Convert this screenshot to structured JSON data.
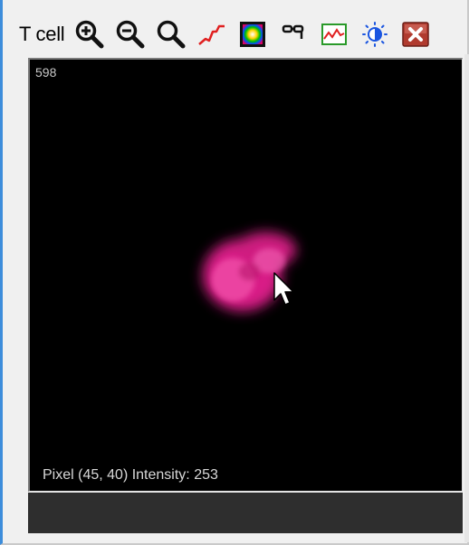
{
  "window": {
    "title": "T cell"
  },
  "toolbar": {
    "buttons": [
      {
        "icon": "zoom-in-icon"
      },
      {
        "icon": "zoom-out-icon"
      },
      {
        "icon": "magnifier-icon"
      },
      {
        "icon": "curve-icon"
      },
      {
        "icon": "colormap-icon"
      },
      {
        "icon": "binoculars-icon"
      },
      {
        "icon": "histogram-icon"
      },
      {
        "icon": "contrast-icon"
      },
      {
        "icon": "close-icon"
      }
    ]
  },
  "viewer": {
    "frame_number": "598",
    "pixel_readout": "Pixel (45, 40) Intensity: 253",
    "background_color": "#000000",
    "cell_color": "#e0218a"
  },
  "colors": {
    "accent_frame": "#3d8ddb",
    "curve_red": "#e02020",
    "contrast_blue": "#1a55e0",
    "close_red": "#c0392b"
  }
}
